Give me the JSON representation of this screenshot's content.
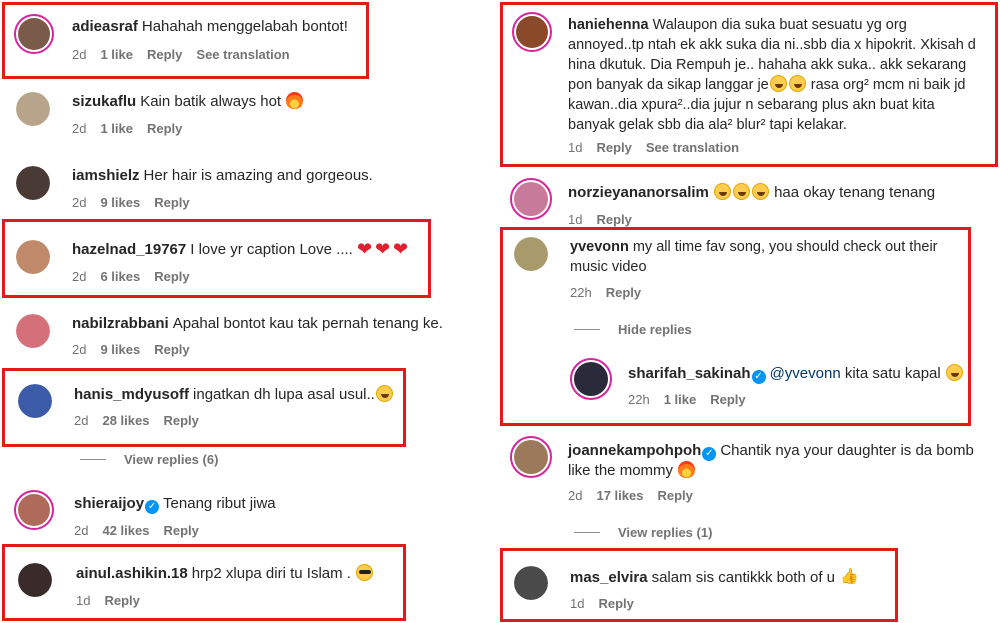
{
  "left": [
    {
      "user": "adieasraf",
      "text": "Hahahah menggelabah bontot!",
      "time": "2d",
      "likes": "1 like",
      "reply": "Reply",
      "extra": "See translation",
      "avatar_color": "#7a5a48"
    },
    {
      "user": "sizukaflu",
      "text": "Kain batik always hot",
      "emoji_after": "fire",
      "time": "2d",
      "likes": "1 like",
      "reply": "Reply",
      "avatar_color": "#b8a48a"
    },
    {
      "user": "iamshielz",
      "text": "Her hair is amazing and gorgeous.",
      "time": "2d",
      "likes": "9 likes",
      "reply": "Reply",
      "avatar_color": "#4a3a36"
    },
    {
      "user": "hazelnad_19767",
      "text": "I love yr caption Love ....",
      "emoji_after": "heart",
      "time": "2d",
      "likes": "6 likes",
      "reply": "Reply",
      "avatar_color": "#c08a6a"
    },
    {
      "user": "nabilzrabbani",
      "text": "Apahal bontot kau tak pernah tenang ke.",
      "time": "2d",
      "likes": "9 likes",
      "reply": "Reply",
      "avatar_color": "#d4707a"
    },
    {
      "user": "hanis_mdyusoff",
      "text": "ingatkan dh lupa asal usul..",
      "emoji_after": "laugh",
      "time": "2d",
      "likes": "28 likes",
      "reply": "Reply",
      "avatar_color": "#3b5aa8"
    },
    {
      "user": "shieraijoy",
      "verified": true,
      "text": "Tenang ribut jiwa",
      "time": "2d",
      "likes": "42 likes",
      "reply": "Reply",
      "avatar_color": "#b06a5a"
    },
    {
      "user": "ainul.ashikin.18",
      "text": "hrp2 xlupa diri tu Islam .",
      "emoji_after": "cool",
      "time": "1d",
      "reply": "Reply",
      "avatar_color": "#3a2a2a"
    }
  ],
  "left_view_replies": "View replies (6)",
  "right": [
    {
      "user": "haniehenna",
      "lines": [
        "Walaupon dia suka buat sesuatu yg org",
        "annoyed..tp ntah ek akk suka dia ni..sbb dia x hipokrit. Xkisah d",
        "hina dkutuk. Dia Rempuh je.. hahaha akk suka.. akk sekarang",
        "pon banyak da sikap langgar je",
        "kawan..dia xpura²..dia jujur n sebarang plus akn buat kita",
        "banyak gelak sbb dia ala² blur² tapi kelakar."
      ],
      "line4_after": "rasa org² mcm ni baik jd",
      "time": "1d",
      "reply": "Reply",
      "extra": "See translation",
      "avatar_color": "#8a4a2a"
    },
    {
      "user": "norzieyananorsalim",
      "text_after": "haa okay tenang tenang",
      "time": "1d",
      "reply": "Reply",
      "avatar_color": "#c87a9a"
    },
    {
      "user": "yvevonn",
      "lines": [
        "my all time fav song, you should check out their",
        "music video"
      ],
      "time": "22h",
      "reply": "Reply",
      "avatar_color": "#a89a6a"
    },
    {
      "user": "sharifah_sakinah",
      "verified": true,
      "mention": "@yvevonn",
      "text": "kita satu kapal",
      "time": "22h",
      "likes": "1 like",
      "reply": "Reply",
      "avatar_color": "#2a2a3a"
    },
    {
      "user": "joannekampohpoh",
      "verified": true,
      "lines": [
        "Chantik nya your daughter is da bomb",
        "like the mommy"
      ],
      "time": "2d",
      "likes": "17 likes",
      "reply": "Reply",
      "avatar_color": "#9a7a5a"
    },
    {
      "user": "mas_elvira",
      "text": "salam sis cantikkk both of u",
      "time": "1d",
      "reply": "Reply",
      "avatar_color": "#4a4a4a"
    }
  ],
  "hide_replies": "Hide replies",
  "right_view_replies": "View replies (1)",
  "highlight_color": "#e11a1a"
}
